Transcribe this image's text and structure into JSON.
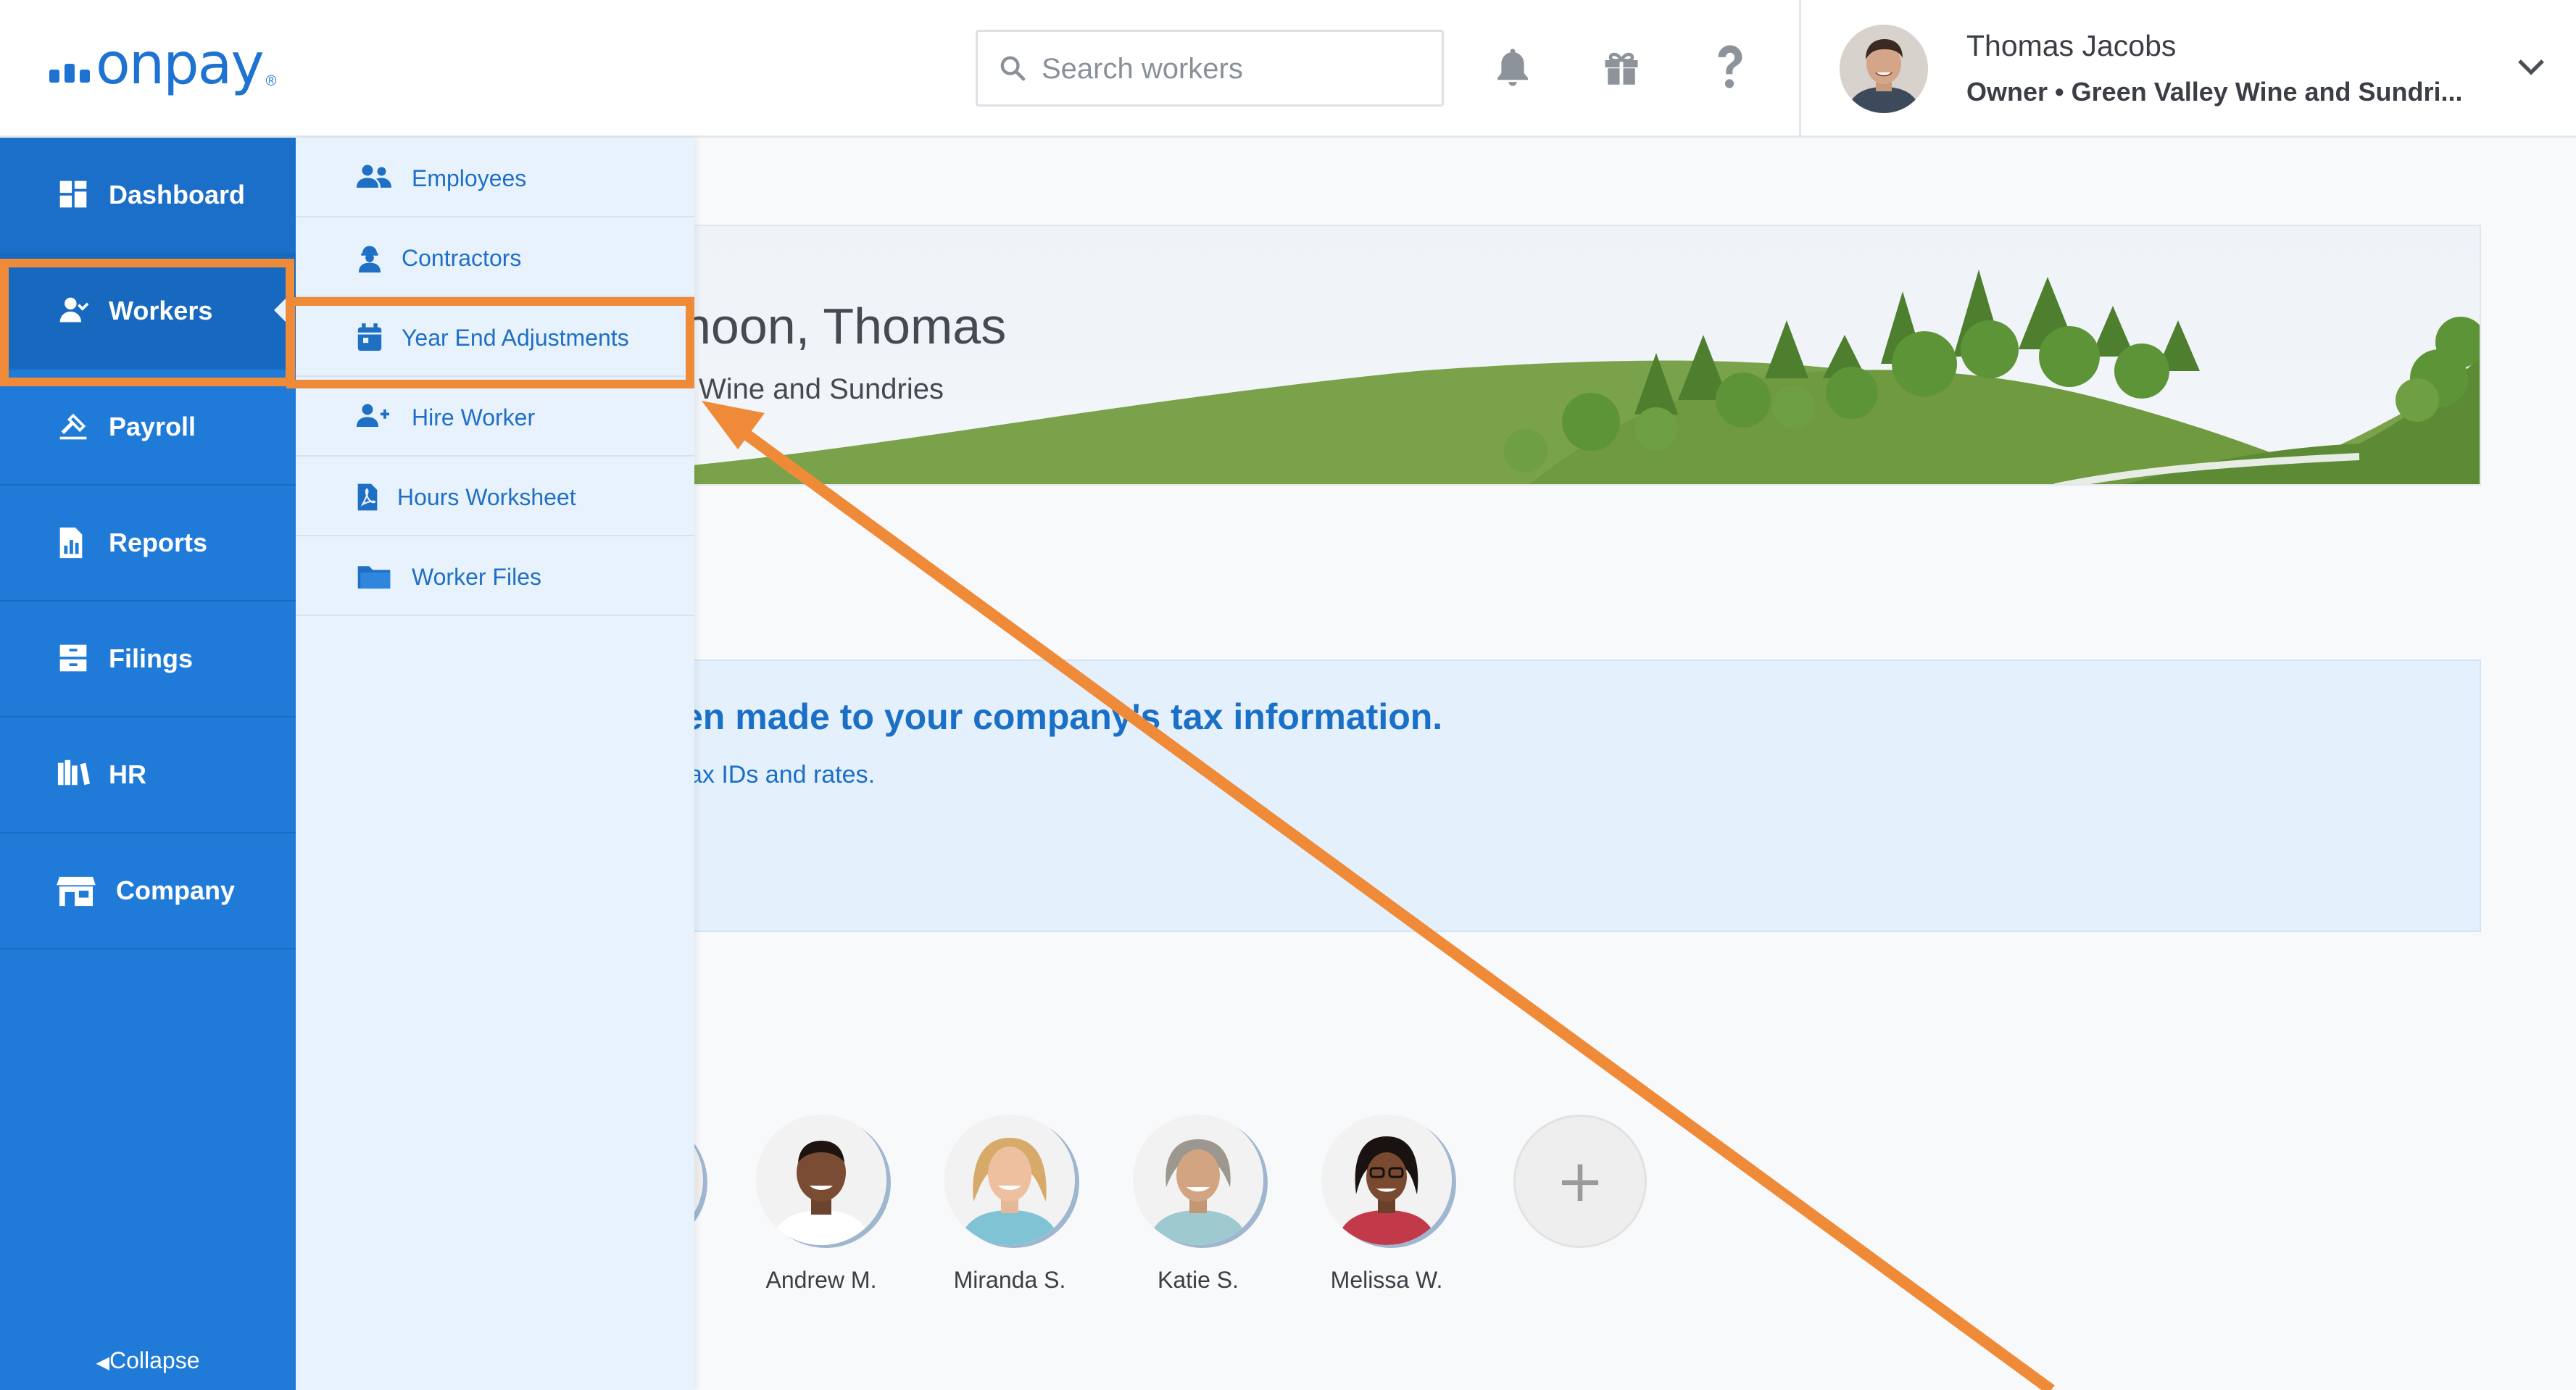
{
  "header": {
    "logo_text": "onpay",
    "logo_reg": "®",
    "search_placeholder": "Search workers",
    "icons": [
      "bell-icon",
      "gift-icon",
      "help-icon"
    ],
    "user": {
      "name": "Thomas Jacobs",
      "role": "Owner",
      "separator": "•",
      "company": "Green Valley Wine and Sundri..."
    }
  },
  "sidebar": {
    "items": [
      {
        "label": "Dashboard",
        "icon": "dashboard-icon"
      },
      {
        "label": "Workers",
        "icon": "workers-icon",
        "active": true
      },
      {
        "label": "Payroll",
        "icon": "payroll-icon"
      },
      {
        "label": "Reports",
        "icon": "reports-icon"
      },
      {
        "label": "Filings",
        "icon": "filings-icon"
      },
      {
        "label": "HR",
        "icon": "hr-icon"
      },
      {
        "label": "Company",
        "icon": "company-icon"
      }
    ],
    "collapse_label": "Collapse"
  },
  "submenu": {
    "items": [
      {
        "label": "Employees",
        "icon": "employees-icon"
      },
      {
        "label": "Contractors",
        "icon": "contractor-icon"
      },
      {
        "label": "Year End Adjustments",
        "icon": "calendar-icon",
        "highlighted": true
      },
      {
        "label": "Hire Worker",
        "icon": "add-user-icon"
      },
      {
        "label": "Hours Worksheet",
        "icon": "pdf-file-icon"
      },
      {
        "label": "Worker Files",
        "icon": "folder-icon"
      }
    ]
  },
  "main": {
    "greeting": "noon, Thomas",
    "company_line": "Wine and Sundries",
    "notice_title": "en made to your company's tax information.",
    "notice_sub": "ax IDs and rates.",
    "workers": [
      {
        "name": "Andrew M."
      },
      {
        "name": "Miranda S."
      },
      {
        "name": "Katie S."
      },
      {
        "name": "Melissa W."
      }
    ],
    "add_worker_symbol": "+"
  },
  "colors": {
    "brand_blue": "#1f7ad8",
    "submenu_bg": "#e8f2fd",
    "link_blue": "#1f6fc4",
    "annotation_orange": "#ef8a38"
  }
}
